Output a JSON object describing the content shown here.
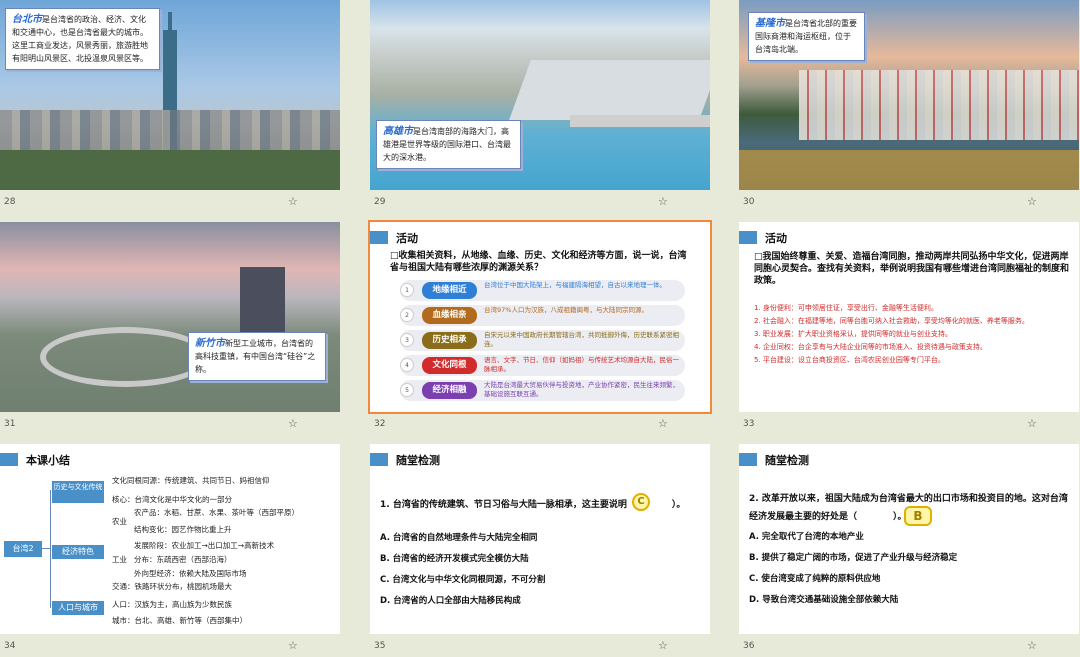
{
  "slides": [
    {
      "num": "28",
      "caption_title": "台北市",
      "caption_body": "是台湾省的政治、经济、文化和交通中心，也是台湾省最大的城市。这里工商业发达，风景秀丽，旅游胜地有阳明山风景区、北投温泉风景区等。"
    },
    {
      "num": "29",
      "caption_title": "高雄市",
      "caption_body": "是台湾南部的海路大门，高雄港是世界等级的国际港口、台湾最大的深水港。"
    },
    {
      "num": "30",
      "caption_title": "基隆市",
      "caption_body": "是台湾省北部的重要国际商港和海运枢纽，位于台湾岛北端。"
    },
    {
      "num": "31",
      "caption_title": "新竹市",
      "caption_body": "新型工业城市，台湾省的高科技重镇，有中国台湾“硅谷”之称。"
    },
    {
      "num": "32",
      "header": "活动",
      "question": "□收集相关资料，从地缘、血缘、历史、文化和经济等方面，说一说，台湾省与祖国大陆有哪些浓厚的渊源关系？",
      "items": [
        {
          "n": "1",
          "tag": "地缘相近",
          "color": "#2f7fd6",
          "text": "台湾位于中国大陆架上，与福建隔海相望，自古以来地理一体。"
        },
        {
          "n": "2",
          "tag": "血缘相亲",
          "color": "#b26a1c",
          "text": "台湾97%人口为汉族，八成祖籍闽粤，与大陆同宗同源。"
        },
        {
          "n": "3",
          "tag": "历史相承",
          "color": "#8a6d1a",
          "text": "自宋元以来中国政府长期管辖台湾，共同抵御外侮，历史联系紧密相连。"
        },
        {
          "n": "4",
          "tag": "文化同根",
          "color": "#d12b2b",
          "text": "语言、文字、节日、信仰（如妈祖）与传统艺术均源自大陆，民俗一脉相承。"
        },
        {
          "n": "5",
          "tag": "经济相融",
          "color": "#7a3fb0",
          "text": "大陆是台湾最大贸易伙伴与投资地，产业协作紧密，民生往来频繁，基础设施互联互通。"
        }
      ]
    },
    {
      "num": "33",
      "header": "活动",
      "question": "□我国始终尊重、关爱、造福台湾同胞，推动两岸共同弘扬中华文化，促进两岸同胞心灵契合。查找有关资料，举例说明我国有哪些增进台湾同胞福祉的制度和政策。",
      "items": [
        "1. 身份便利：可申领居住证，享受出行、金融等生活便利。",
        "2. 社会融入：在福建等地，同等台胞可纳入社会救助，享受均等化的就医、养老等服务。",
        "3. 职业发展：扩大职业资格采认，提供同等的就业与创业支持。",
        "4. 企业同权：台企享有与大陆企业同等的市场准入、投资待遇与政策支持。",
        "5. 平台建设：设立台商投资区、台湾农民创业园等专门平台。"
      ]
    },
    {
      "num": "34",
      "header": "本课小结",
      "root": "台湾2",
      "branches": [
        "历史与文化传统",
        "经济特色",
        "人口与城市"
      ],
      "leaves": [
        "文化同根同源：传统建筑、共同节日、妈祖信仰",
        "核心：台湾文化是中华文化的一部分",
        "农业",
        "农产品：水稻、甘蔗、水果、茶叶等（西部平原）",
        "结构变化：园艺作物比重上升",
        "工业",
        "发展阶段：农业加工→出口加工→高新技术",
        "分布：东疏西密（西部沿海）",
        "外向型经济：依赖大陆及国际市场",
        "交通：铁路环状分布，桃园机场最大",
        "人口：汉族为主，高山族为少数民族",
        "城市：台北、高雄、新竹等（西部集中）"
      ]
    },
    {
      "num": "35",
      "header": "随堂检测",
      "question": "1. 台湾省的传统建筑、节日习俗与大陆一脉相承，这主要说明（　　　　）。",
      "answer": "C",
      "options": [
        "A. 台湾省的自然地理条件与大陆完全相同",
        "B. 台湾省的经济开发模式完全模仿大陆",
        "C. 台湾文化与中华文化同根同源，不可分割",
        "D. 台湾省的人口全部由大陆移民构成"
      ]
    },
    {
      "num": "36",
      "header": "随堂检测",
      "question": "2. 改革开放以来，祖国大陆成为台湾省最大的出口市场和投资目的地。这对台湾经济发展最主要的好处是（　　　　）。",
      "answer": "B",
      "options": [
        "A. 完全取代了台湾的本地产业",
        "B. 提供了稳定广阔的市场，促进了产业升级与经济稳定",
        "C. 使台湾变成了纯粹的原料供应地",
        "D. 导致台湾交通基础设施全部依赖大陆"
      ]
    }
  ]
}
